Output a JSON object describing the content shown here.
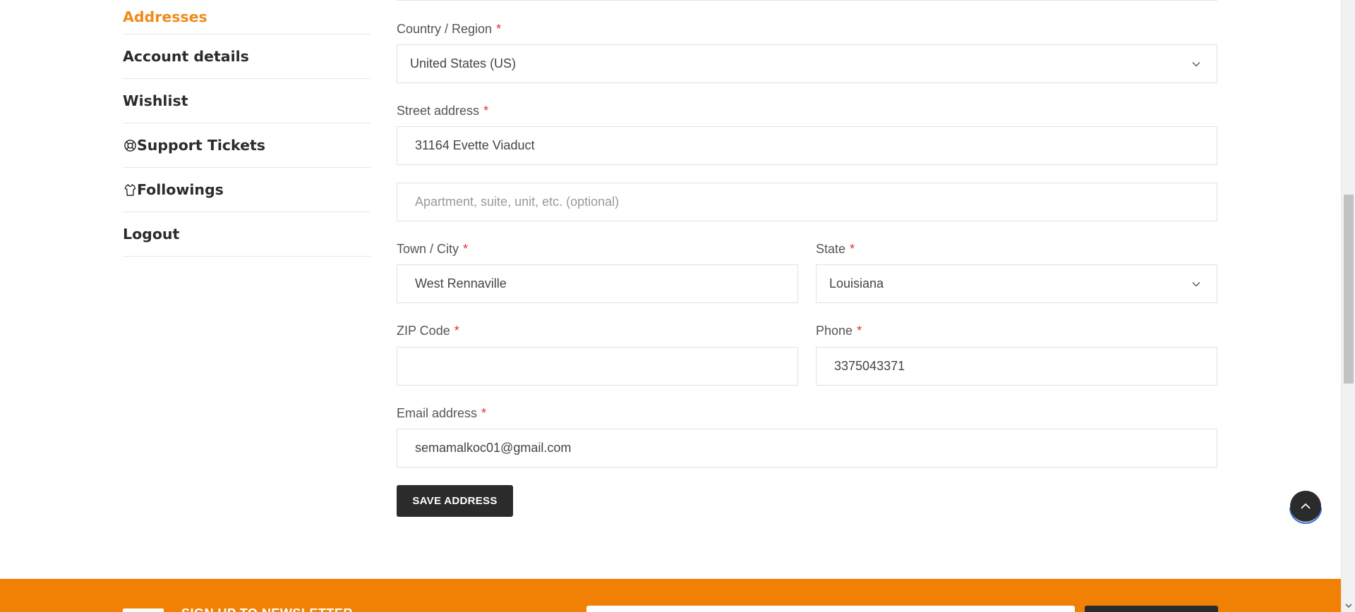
{
  "sidebar": {
    "items": [
      {
        "label": "Addresses",
        "active": true,
        "icon": ""
      },
      {
        "label": "Account details",
        "active": false,
        "icon": ""
      },
      {
        "label": "Wishlist",
        "active": false,
        "icon": ""
      },
      {
        "label": "Support Tickets",
        "active": false,
        "icon": "lifebuoy-icon"
      },
      {
        "label": "Followings",
        "active": false,
        "icon": "shirt-icon"
      },
      {
        "label": "Logout",
        "active": false,
        "icon": ""
      }
    ]
  },
  "form": {
    "country": {
      "label": "Country / Region",
      "required": "*",
      "value": "United States (US)"
    },
    "street": {
      "label": "Street address",
      "required": "*",
      "value": "31164 Evette Viaduct"
    },
    "street2": {
      "placeholder": "Apartment, suite, unit, etc. (optional)"
    },
    "city": {
      "label": "Town / City",
      "required": "*",
      "value": "West Rennaville"
    },
    "state": {
      "label": "State",
      "required": "*",
      "value": "Louisiana"
    },
    "zip": {
      "label": "ZIP Code",
      "required": "*",
      "value": ""
    },
    "phone": {
      "label": "Phone",
      "required": "*",
      "value": "3375043371"
    },
    "email": {
      "label": "Email address",
      "required": "*",
      "value": "semamalkoc01@gmail.com"
    },
    "save_label": "SAVE ADDRESS"
  },
  "footer": {
    "signup_text": "SIGN UP TO NEWSLETTER"
  },
  "colors": {
    "accent": "#f18a1b",
    "footer_bg": "#f18104",
    "dark": "#2b2b2b",
    "required": "#e03232"
  }
}
